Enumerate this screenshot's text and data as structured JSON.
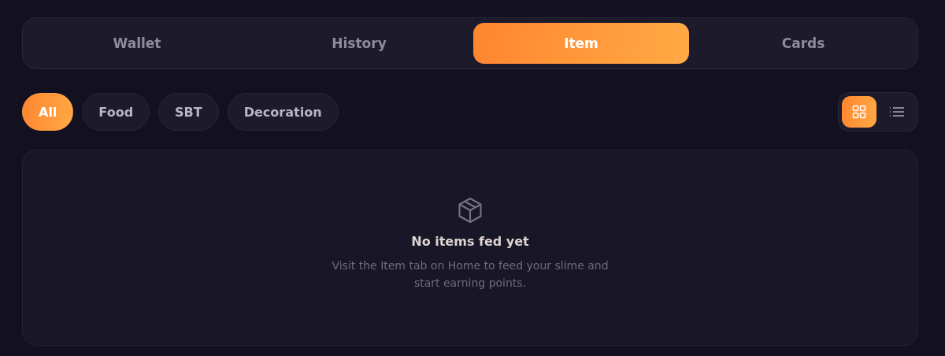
{
  "tabs": [
    {
      "label": "Wallet",
      "selected": false
    },
    {
      "label": "History",
      "selected": false
    },
    {
      "label": "Item",
      "selected": true
    },
    {
      "label": "Cards",
      "selected": false
    }
  ],
  "filters": [
    {
      "label": "All",
      "selected": true
    },
    {
      "label": "Food",
      "selected": false
    },
    {
      "label": "SBT",
      "selected": false
    },
    {
      "label": "Decoration",
      "selected": false
    }
  ],
  "view_modes": [
    {
      "kind": "grid",
      "selected": true
    },
    {
      "kind": "list",
      "selected": false
    }
  ],
  "empty_state": {
    "title": "No items fed yet",
    "message": "Visit the Item tab on Home to feed your slime and start earning points."
  }
}
